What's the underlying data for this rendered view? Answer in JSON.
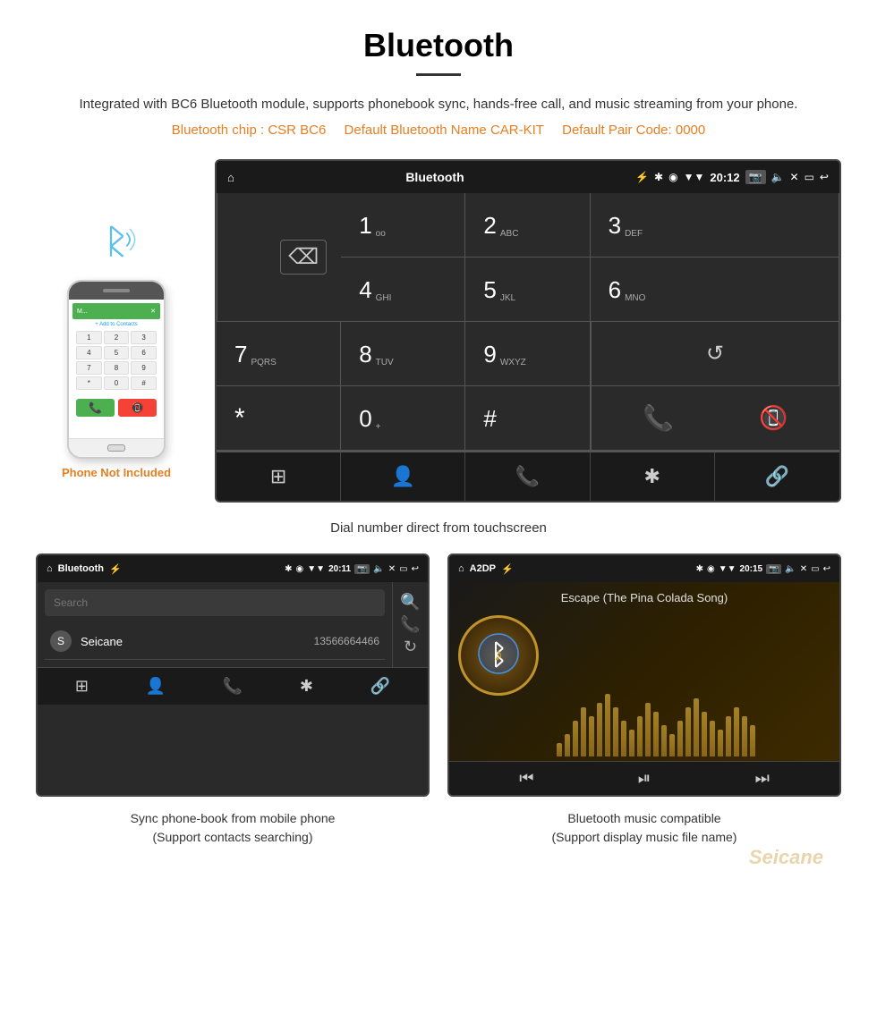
{
  "page": {
    "title": "Bluetooth",
    "description": "Integrated with BC6 Bluetooth module, supports phonebook sync, hands-free call, and music streaming from your phone.",
    "specs_chip": "Bluetooth chip : CSR BC6",
    "specs_name": "Default Bluetooth Name CAR-KIT",
    "specs_code": "Default Pair Code: 0000",
    "dial_caption": "Dial number direct from touchscreen",
    "phonebook_caption_line1": "Sync phone-book from mobile phone",
    "phonebook_caption_line2": "(Support contacts searching)",
    "music_caption_line1": "Bluetooth music compatible",
    "music_caption_line2": "(Support display music file name)"
  },
  "dial_screen": {
    "status_bar": {
      "title": "Bluetooth",
      "time": "20:12",
      "home_icon": "⌂",
      "usb_icon": "⚡",
      "bluetooth_icon": "⚡",
      "location_icon": "◉",
      "signal_icon": "▼",
      "camera_icon": "📷",
      "volume_icon": "🔊",
      "x_icon": "✕",
      "rect_icon": "▭",
      "back_icon": "↩"
    },
    "keys": [
      {
        "number": "1",
        "letters": "oo"
      },
      {
        "number": "2",
        "letters": "ABC"
      },
      {
        "number": "3",
        "letters": "DEF"
      },
      {
        "number": "4",
        "letters": "GHI"
      },
      {
        "number": "5",
        "letters": "JKL"
      },
      {
        "number": "6",
        "letters": "MNO"
      },
      {
        "number": "7",
        "letters": "PQRS"
      },
      {
        "number": "8",
        "letters": "TUV"
      },
      {
        "number": "9",
        "letters": "WXYZ"
      },
      {
        "number": "*",
        "letters": ""
      },
      {
        "number": "0",
        "letters": "+"
      },
      {
        "number": "#",
        "letters": ""
      }
    ],
    "nav_icons": [
      "⊞",
      "👤",
      "📞",
      "✱",
      "🔗"
    ]
  },
  "phonebook_screen": {
    "status_bar": {
      "title": "Bluetooth",
      "time": "20:11",
      "home_icon": "⌂",
      "usb_icon": "⚡"
    },
    "search_placeholder": "Search",
    "contacts": [
      {
        "letter": "S",
        "name": "Seicane",
        "number": "13566664466"
      }
    ],
    "nav_icons": [
      "⊞",
      "👤",
      "📞",
      "✱",
      "🔗"
    ]
  },
  "music_screen": {
    "status_bar": {
      "title": "A2DP",
      "time": "20:15",
      "home_icon": "⌂",
      "usb_icon": "⚡"
    },
    "song_title": "Escape (The Pina Colada Song)",
    "nav_icons": [
      "⏮",
      "⏯",
      "⏭"
    ],
    "eq_bars": [
      15,
      25,
      40,
      55,
      45,
      60,
      70,
      55,
      40,
      30,
      45,
      60,
      50,
      35,
      25,
      40,
      55,
      65,
      50,
      40,
      30,
      45,
      55,
      45,
      35
    ]
  },
  "phone_mockup": {
    "not_included_label": "Phone Not Included",
    "add_to_contacts": "+ Add to Contacts",
    "keys": [
      "1",
      "2",
      "3",
      "4",
      "5",
      "6",
      "7",
      "8",
      "9",
      "*",
      "0",
      "#"
    ]
  },
  "watermark": "Seicane"
}
